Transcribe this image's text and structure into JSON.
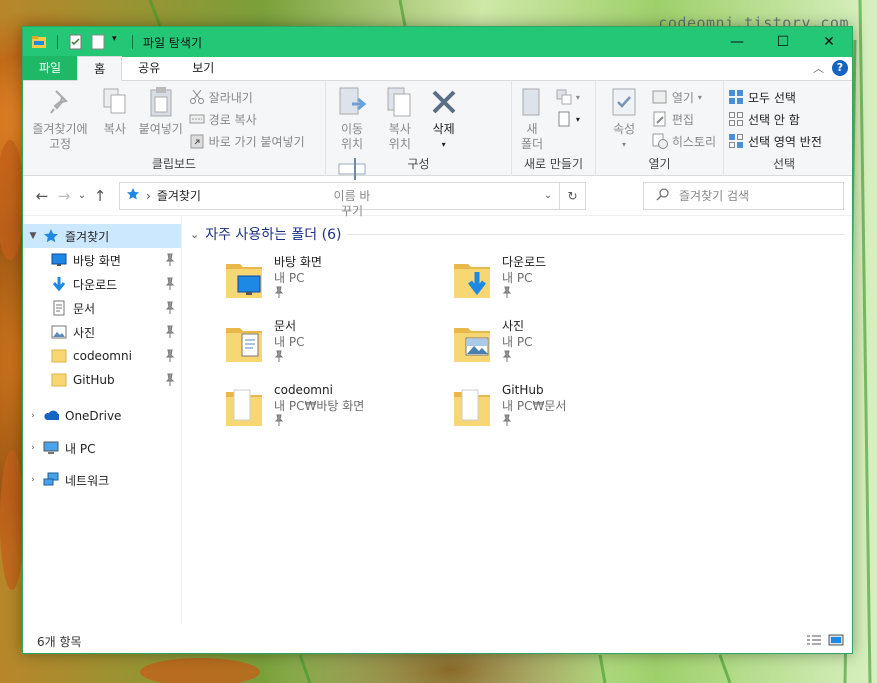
{
  "watermark": "codeomni.tistory.com",
  "window": {
    "title": "파일 탐색기",
    "controls": {
      "minimize": "—",
      "maximize": "☐",
      "close": "✕"
    }
  },
  "ribbon_tabs": [
    {
      "label": "파일"
    },
    {
      "label": "홈"
    },
    {
      "label": "공유"
    },
    {
      "label": "보기"
    }
  ],
  "ribbon": {
    "clipboard": {
      "label": "클립보드",
      "pin_quick": "즐겨찾기에 고정",
      "copy": "복사",
      "paste": "붙여넣기",
      "cut": "잘라내기",
      "copy_path": "경로 복사",
      "paste_shortcut": "바로 가기 붙여넣기"
    },
    "organize": {
      "label": "구성",
      "move_to": "이동 위치",
      "copy_to": "복사 위치",
      "delete": "삭제",
      "rename": "이름 바꾸기"
    },
    "new": {
      "label": "새로 만들기",
      "new_folder": "새 폴더"
    },
    "open": {
      "label": "열기",
      "properties": "속성",
      "open": "열기",
      "edit": "편집",
      "history": "히스토리"
    },
    "select": {
      "label": "선택",
      "select_all": "모두 선택",
      "select_none": "선택 안 함",
      "invert": "선택 영역 반전"
    }
  },
  "address": {
    "path": "즐겨찾기",
    "search_placeholder": "즐겨찾기 검색"
  },
  "nav": {
    "quick_access": "즐겨찾기",
    "items": [
      {
        "label": "바탕 화면",
        "icon": "desktop-icon"
      },
      {
        "label": "다운로드",
        "icon": "download-icon"
      },
      {
        "label": "문서",
        "icon": "document-icon"
      },
      {
        "label": "사진",
        "icon": "picture-icon"
      },
      {
        "label": "codeomni",
        "icon": "folder-icon"
      },
      {
        "label": "GitHub",
        "icon": "folder-icon"
      }
    ],
    "onedrive": "OneDrive",
    "this_pc": "내 PC",
    "network": "네트워크"
  },
  "content": {
    "group_title": "자주 사용하는 폴더 (6)",
    "folders": [
      {
        "name": "바탕 화면",
        "location": "내 PC",
        "overlay": "desktop"
      },
      {
        "name": "다운로드",
        "location": "내 PC",
        "overlay": "download"
      },
      {
        "name": "문서",
        "location": "내 PC",
        "overlay": "document"
      },
      {
        "name": "사진",
        "location": "내 PC",
        "overlay": "picture"
      },
      {
        "name": "codeomni",
        "location": "내 PC₩바탕 화면",
        "overlay": "plain"
      },
      {
        "name": "GitHub",
        "location": "내 PC₩문서",
        "overlay": "plain"
      }
    ]
  },
  "status": {
    "count": "6개 항목"
  },
  "colors": {
    "titlebar": "#24c776",
    "file_tab": "#1fb866",
    "selection": "#cce8ff",
    "folder": "#f7d774",
    "accent_blue": "#1e88e5"
  }
}
